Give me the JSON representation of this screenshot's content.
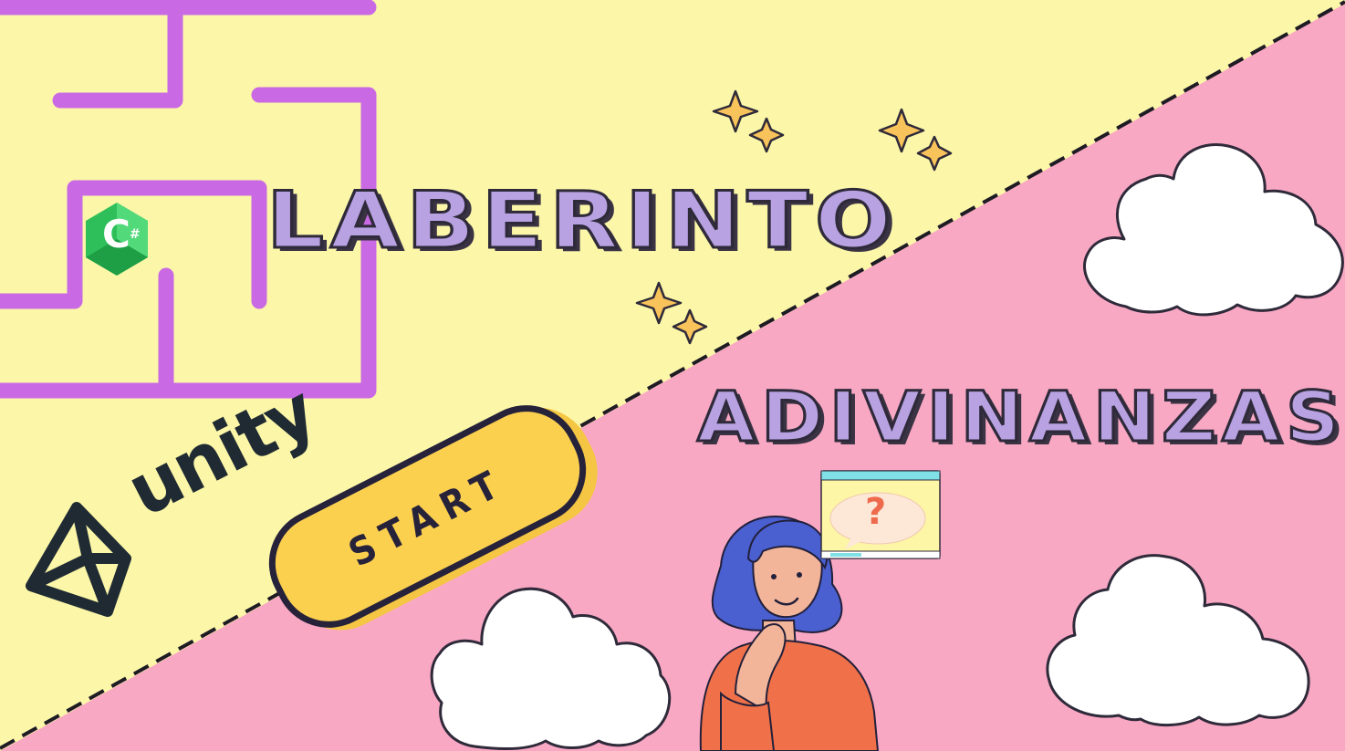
{
  "titles": {
    "laberinto": "LABERINTO",
    "adivinanzas": "ADIVINANZAS"
  },
  "start_button": {
    "label": "START"
  },
  "logos": {
    "unity": "unity",
    "csharp_letter": "C",
    "csharp_hash": "#"
  },
  "thought_popup": {
    "symbol": "?"
  },
  "colors": {
    "yellow_panel": "#fcf7a8",
    "pink_panel": "#f9a8c4",
    "maze": "#c96ae4",
    "title_fill": "#b8a2e2",
    "button": "#fcd04f",
    "outline": "#26223a",
    "sparkle": "#f8c35a",
    "cloud": "#ffffff",
    "shirt": "#f07149",
    "hair": "#4a5fd0"
  },
  "icons": [
    "maze-graphic",
    "sparkle-icon",
    "cloud-icon",
    "unity-logo-icon",
    "csharp-logo-icon",
    "window-icon",
    "thinking-person"
  ]
}
